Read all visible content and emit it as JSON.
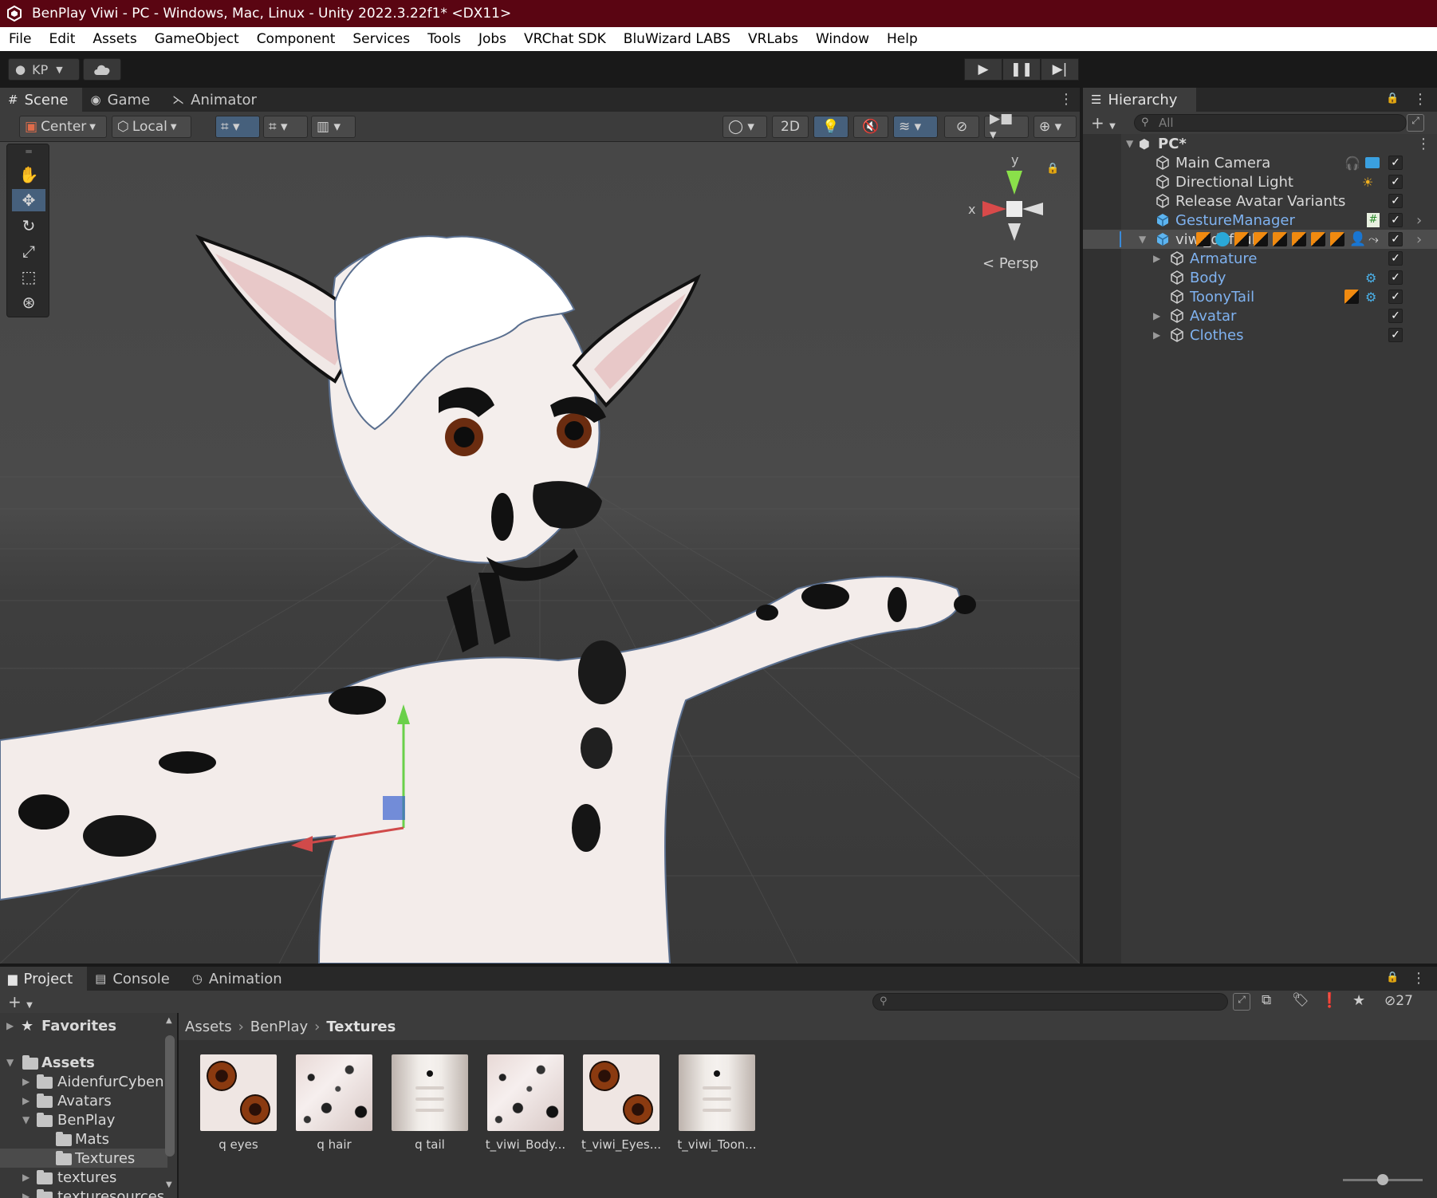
{
  "window": {
    "title": "BenPlay Viwi - PC - Windows, Mac, Linux - Unity 2022.3.22f1* <DX11>"
  },
  "menu": [
    "File",
    "Edit",
    "Assets",
    "GameObject",
    "Component",
    "Services",
    "Tools",
    "Jobs",
    "VRChat SDK",
    "BluWizard LABS",
    "VRLabs",
    "Window",
    "Help"
  ],
  "toolbar": {
    "account": "KP"
  },
  "scene_tabs": [
    {
      "label": "Scene",
      "icon": "grid-icon"
    },
    {
      "label": "Game",
      "icon": "gamepad-icon"
    },
    {
      "label": "Animator",
      "icon": "animator-icon"
    }
  ],
  "scene_toolbar": {
    "pivot": "Center",
    "space": "Local",
    "mode_2d": "2D"
  },
  "scene_view": {
    "projection": "Persp",
    "axis_x": "x",
    "axis_y": "y"
  },
  "hierarchy": {
    "tab": "Hierarchy",
    "search_placeholder": "All",
    "scene_name": "PC*",
    "rows": [
      {
        "name": "Main Camera",
        "prefab": false,
        "indent": 1
      },
      {
        "name": "Directional Light",
        "prefab": false,
        "indent": 1
      },
      {
        "name": "Release Avatar Variants",
        "prefab": false,
        "indent": 1
      },
      {
        "name": "GestureManager",
        "prefab": true,
        "indent": 1
      },
      {
        "name": "viwi_default",
        "prefab": false,
        "indent": 1,
        "selected": true
      },
      {
        "name": "Armature",
        "prefab": true,
        "indent": 2
      },
      {
        "name": "Body",
        "prefab": true,
        "indent": 2
      },
      {
        "name": "ToonyTail",
        "prefab": true,
        "indent": 2
      },
      {
        "name": "Avatar",
        "prefab": true,
        "indent": 2
      },
      {
        "name": "Clothes",
        "prefab": true,
        "indent": 2
      }
    ]
  },
  "bottom_tabs": [
    {
      "label": "Project",
      "icon": "folder-icon"
    },
    {
      "label": "Console",
      "icon": "console-icon"
    },
    {
      "label": "Animation",
      "icon": "clock-icon"
    }
  ],
  "project": {
    "hidden_count": "27",
    "tree": [
      {
        "label": "Favorites",
        "bold": true
      },
      {
        "label": "Assets",
        "bold": true
      },
      {
        "label": "AidenfurCyben"
      },
      {
        "label": "Avatars"
      },
      {
        "label": "BenPlay"
      },
      {
        "label": "Mats"
      },
      {
        "label": "Textures",
        "selected": true
      },
      {
        "label": "textures"
      },
      {
        "label": "texturesources"
      }
    ],
    "breadcrumb": [
      "Assets",
      "BenPlay",
      "Textures"
    ],
    "assets": [
      {
        "label": "q eyes",
        "kind": "eyes"
      },
      {
        "label": "q hair",
        "kind": "hair"
      },
      {
        "label": "q tail",
        "kind": "tail"
      },
      {
        "label": "t_viwi_Body...",
        "kind": "hair"
      },
      {
        "label": "t_viwi_Eyes...",
        "kind": "eyes"
      },
      {
        "label": "t_viwi_Toon...",
        "kind": "tail"
      }
    ]
  },
  "colors": {
    "title_bar": "#5a0512",
    "prefab_text": "#7fb2f0",
    "selection": "#46607c"
  }
}
